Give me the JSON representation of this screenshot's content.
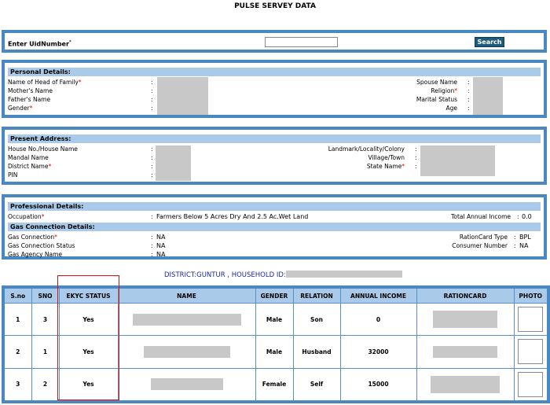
{
  "page": {
    "title": "PULSE SERVEY DATA"
  },
  "search": {
    "label": "Enter UidNumber",
    "marker": "*",
    "value": "",
    "placeholder": "",
    "button": "Search"
  },
  "personal": {
    "header": "Personal Details:",
    "head_of_family": "Name of Head of Family",
    "mother": "Mother's Name",
    "father": "Father's Name",
    "gender": "Gender",
    "spouse": "Spouse Name",
    "religion": "Religion",
    "marital": "Marital Status",
    "age": "Age"
  },
  "address": {
    "header": "Present Address:",
    "house": "House No./House Name",
    "mandal": "Mandal Name",
    "district": "District Name",
    "pin": "PIN",
    "landmark": "Landmark/Locality/Colony",
    "village": "Village/Town",
    "state": "State Name"
  },
  "professional": {
    "header": "Professional Details:",
    "occupation_label": "Occupation",
    "occupation_value": "Farmers Below 5 Acres Dry And 2.5 Ac.Wet Land",
    "income_label": "Total Annual Income",
    "income_value": "0.0"
  },
  "gas": {
    "header": "Gas Connection Details:",
    "connection_label": "Gas Connection",
    "connection_value": "NA",
    "status_label": "Gas Connection Status",
    "status_value": "NA",
    "agency_label": "Gas Agency Name",
    "agency_value": "NA",
    "rationcard_label": "RationCard Type",
    "rationcard_value": "BPL",
    "consumer_label": "Consumer Number",
    "consumer_value": "NA"
  },
  "colon": ":",
  "household": {
    "text": "DISTRICT:GUNTUR , HOUSEHOLD ID:"
  },
  "table": {
    "headers": [
      "S.no",
      "SNO",
      "EKYC STATUS",
      "NAME",
      "GENDER",
      "RELATION",
      "ANNUAL INCOME",
      "RATIONCARD",
      "PHOTO"
    ],
    "rows": [
      {
        "sno": "1",
        "sno2": "3",
        "ekyc": "Yes",
        "gender": "Male",
        "relation": "Son",
        "income": "0"
      },
      {
        "sno": "2",
        "sno2": "1",
        "ekyc": "Yes",
        "gender": "Male",
        "relation": "Husband",
        "income": "32000"
      },
      {
        "sno": "3",
        "sno2": "2",
        "ekyc": "Yes",
        "gender": "Female",
        "relation": "Self",
        "income": "15000"
      }
    ]
  },
  "colors": {
    "border": "#4a88c4",
    "header_bg": "#a9cbe9",
    "button_bg": "#1e5a7c",
    "district_text": "#1a2aa0",
    "highlight": "#e01010",
    "required": "#e00000"
  }
}
